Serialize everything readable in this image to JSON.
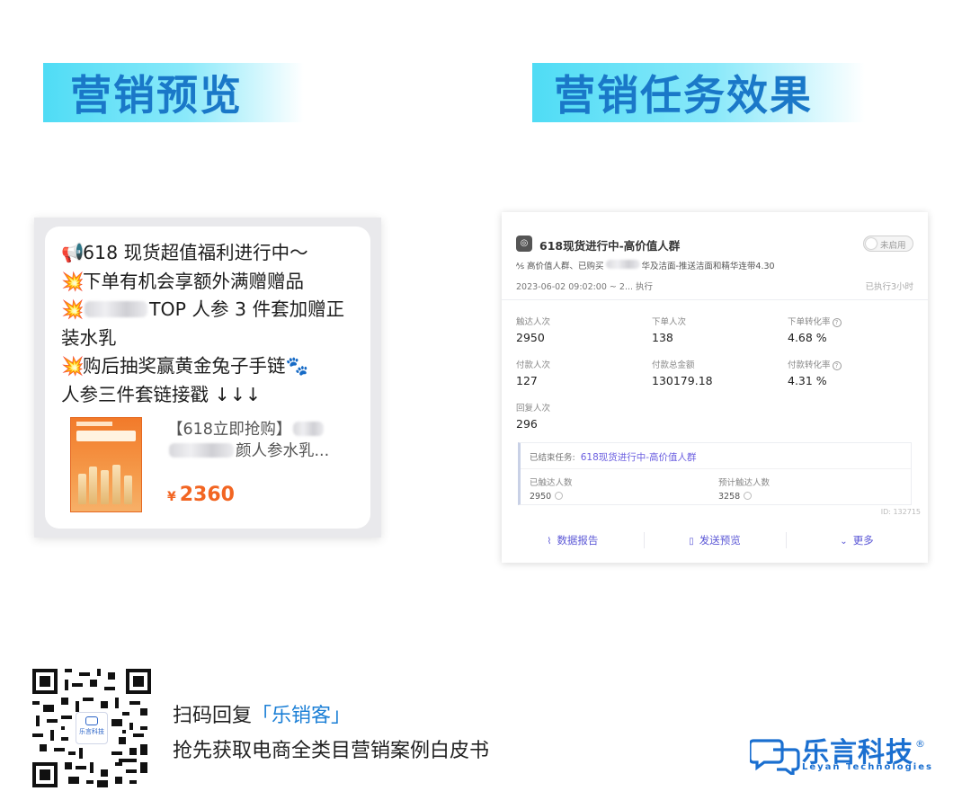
{
  "headers": {
    "left_title": "营销预览",
    "right_title": "营销任务效果"
  },
  "preview": {
    "lines": [
      {
        "emoji": "📢",
        "text": "618 现货超值福利进行中～"
      },
      {
        "emoji": "💥",
        "text": "下单有机会享额外满赠赠品"
      },
      {
        "emoji": "💥",
        "text": "TOP 人参 3 件套加赠正"
      },
      {
        "emoji": "",
        "text": "装水乳"
      },
      {
        "emoji": "💥",
        "text": "购后抽奖赢黄金兔子手链🐾"
      },
      {
        "emoji": "",
        "text": "人参三件套链接戳 ↓↓↓"
      }
    ],
    "product": {
      "title_line1": "【618立即抢购】",
      "title_line2": "颜人参水乳...",
      "currency": "¥",
      "price": "2360"
    }
  },
  "task": {
    "title": "618现货进行中-高价值人群",
    "status_label": "未启用",
    "desc_prefix": "高价值人群、已购买",
    "desc_suffix": "华及洁面-推送洁面和精华连带4.30",
    "time": "2023-06-02 09:02:00 ~ 2... 执行",
    "elapsed": "已执行3小时",
    "metrics": [
      {
        "label": "触达人次",
        "value": "2950",
        "help": false
      },
      {
        "label": "下单人次",
        "value": "138",
        "help": false
      },
      {
        "label": "下单转化率",
        "value": "4.68 %",
        "help": true
      },
      {
        "label": "付款人次",
        "value": "127",
        "help": false
      },
      {
        "label": "付款总金额",
        "value": "130179.18",
        "help": false
      },
      {
        "label": "付款转化率",
        "value": "4.31 %",
        "help": true
      },
      {
        "label": "回复人次",
        "value": "296",
        "help": false
      }
    ],
    "ended": {
      "label": "已结束任务:",
      "link": "618现货进行中-高价值人群",
      "reached_label": "已触达人数",
      "reached_value": "2950",
      "expected_label": "预计触达人数",
      "expected_value": "3258"
    },
    "id_text": "ID: 132715",
    "actions": {
      "report": "数据报告",
      "preview": "发送预览",
      "more": "更多"
    }
  },
  "footer": {
    "cta_prefix": "扫码回复",
    "cta_highlight": "「乐销客」",
    "cta_line2": "抢先获取电商全类目营销案例白皮书",
    "qr_center_text": "乐言科技",
    "brand_cn": "乐言科技",
    "brand_reg": "®",
    "brand_en": "Leyan Technologies"
  },
  "colors": {
    "header_text": "#1a78c8",
    "header_bg": "#4fdcf5",
    "price": "#f26522",
    "link": "#5b57d6",
    "brand": "#1a6fd0"
  }
}
